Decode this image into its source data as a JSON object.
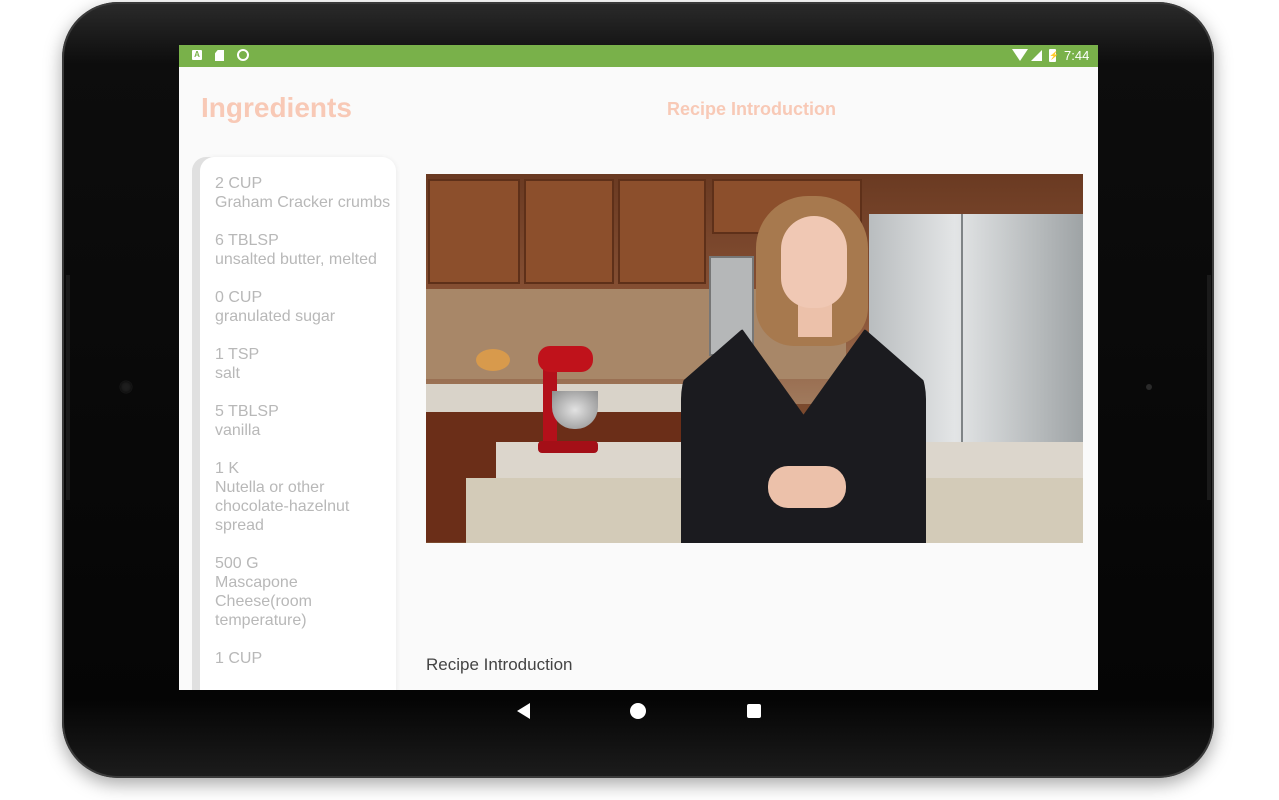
{
  "status_bar": {
    "time": "7:44",
    "icons": [
      "a-notification-icon",
      "sd-card-icon",
      "sync-circle-icon",
      "wifi-icon",
      "cellular-signal-icon",
      "battery-charging-icon"
    ]
  },
  "ingredients": {
    "title": "Ingredients",
    "items": [
      {
        "quantity": "2 CUP",
        "name": "Graham Cracker crumbs"
      },
      {
        "quantity": "6 TBLSP",
        "name": "unsalted butter, melted"
      },
      {
        "quantity": "0 CUP",
        "name": "granulated sugar"
      },
      {
        "quantity": "1 TSP",
        "name": "salt"
      },
      {
        "quantity": "5 TBLSP",
        "name": "vanilla"
      },
      {
        "quantity": "1 K",
        "name": "Nutella or other chocolate-hazelnut spread"
      },
      {
        "quantity": "500 G",
        "name": "Mascapone Cheese(room temperature)"
      },
      {
        "quantity": "1 CUP",
        "name": ""
      }
    ]
  },
  "recipe": {
    "title": "Recipe Introduction",
    "step_caption": "Recipe Introduction"
  },
  "colors": {
    "status_bar": "#79b14a",
    "title_accent": "#f8c9b6",
    "ingredient_text": "#b8b8b8"
  },
  "nav_bar": {
    "icons": [
      "back-icon",
      "home-icon",
      "recent-apps-icon"
    ]
  }
}
